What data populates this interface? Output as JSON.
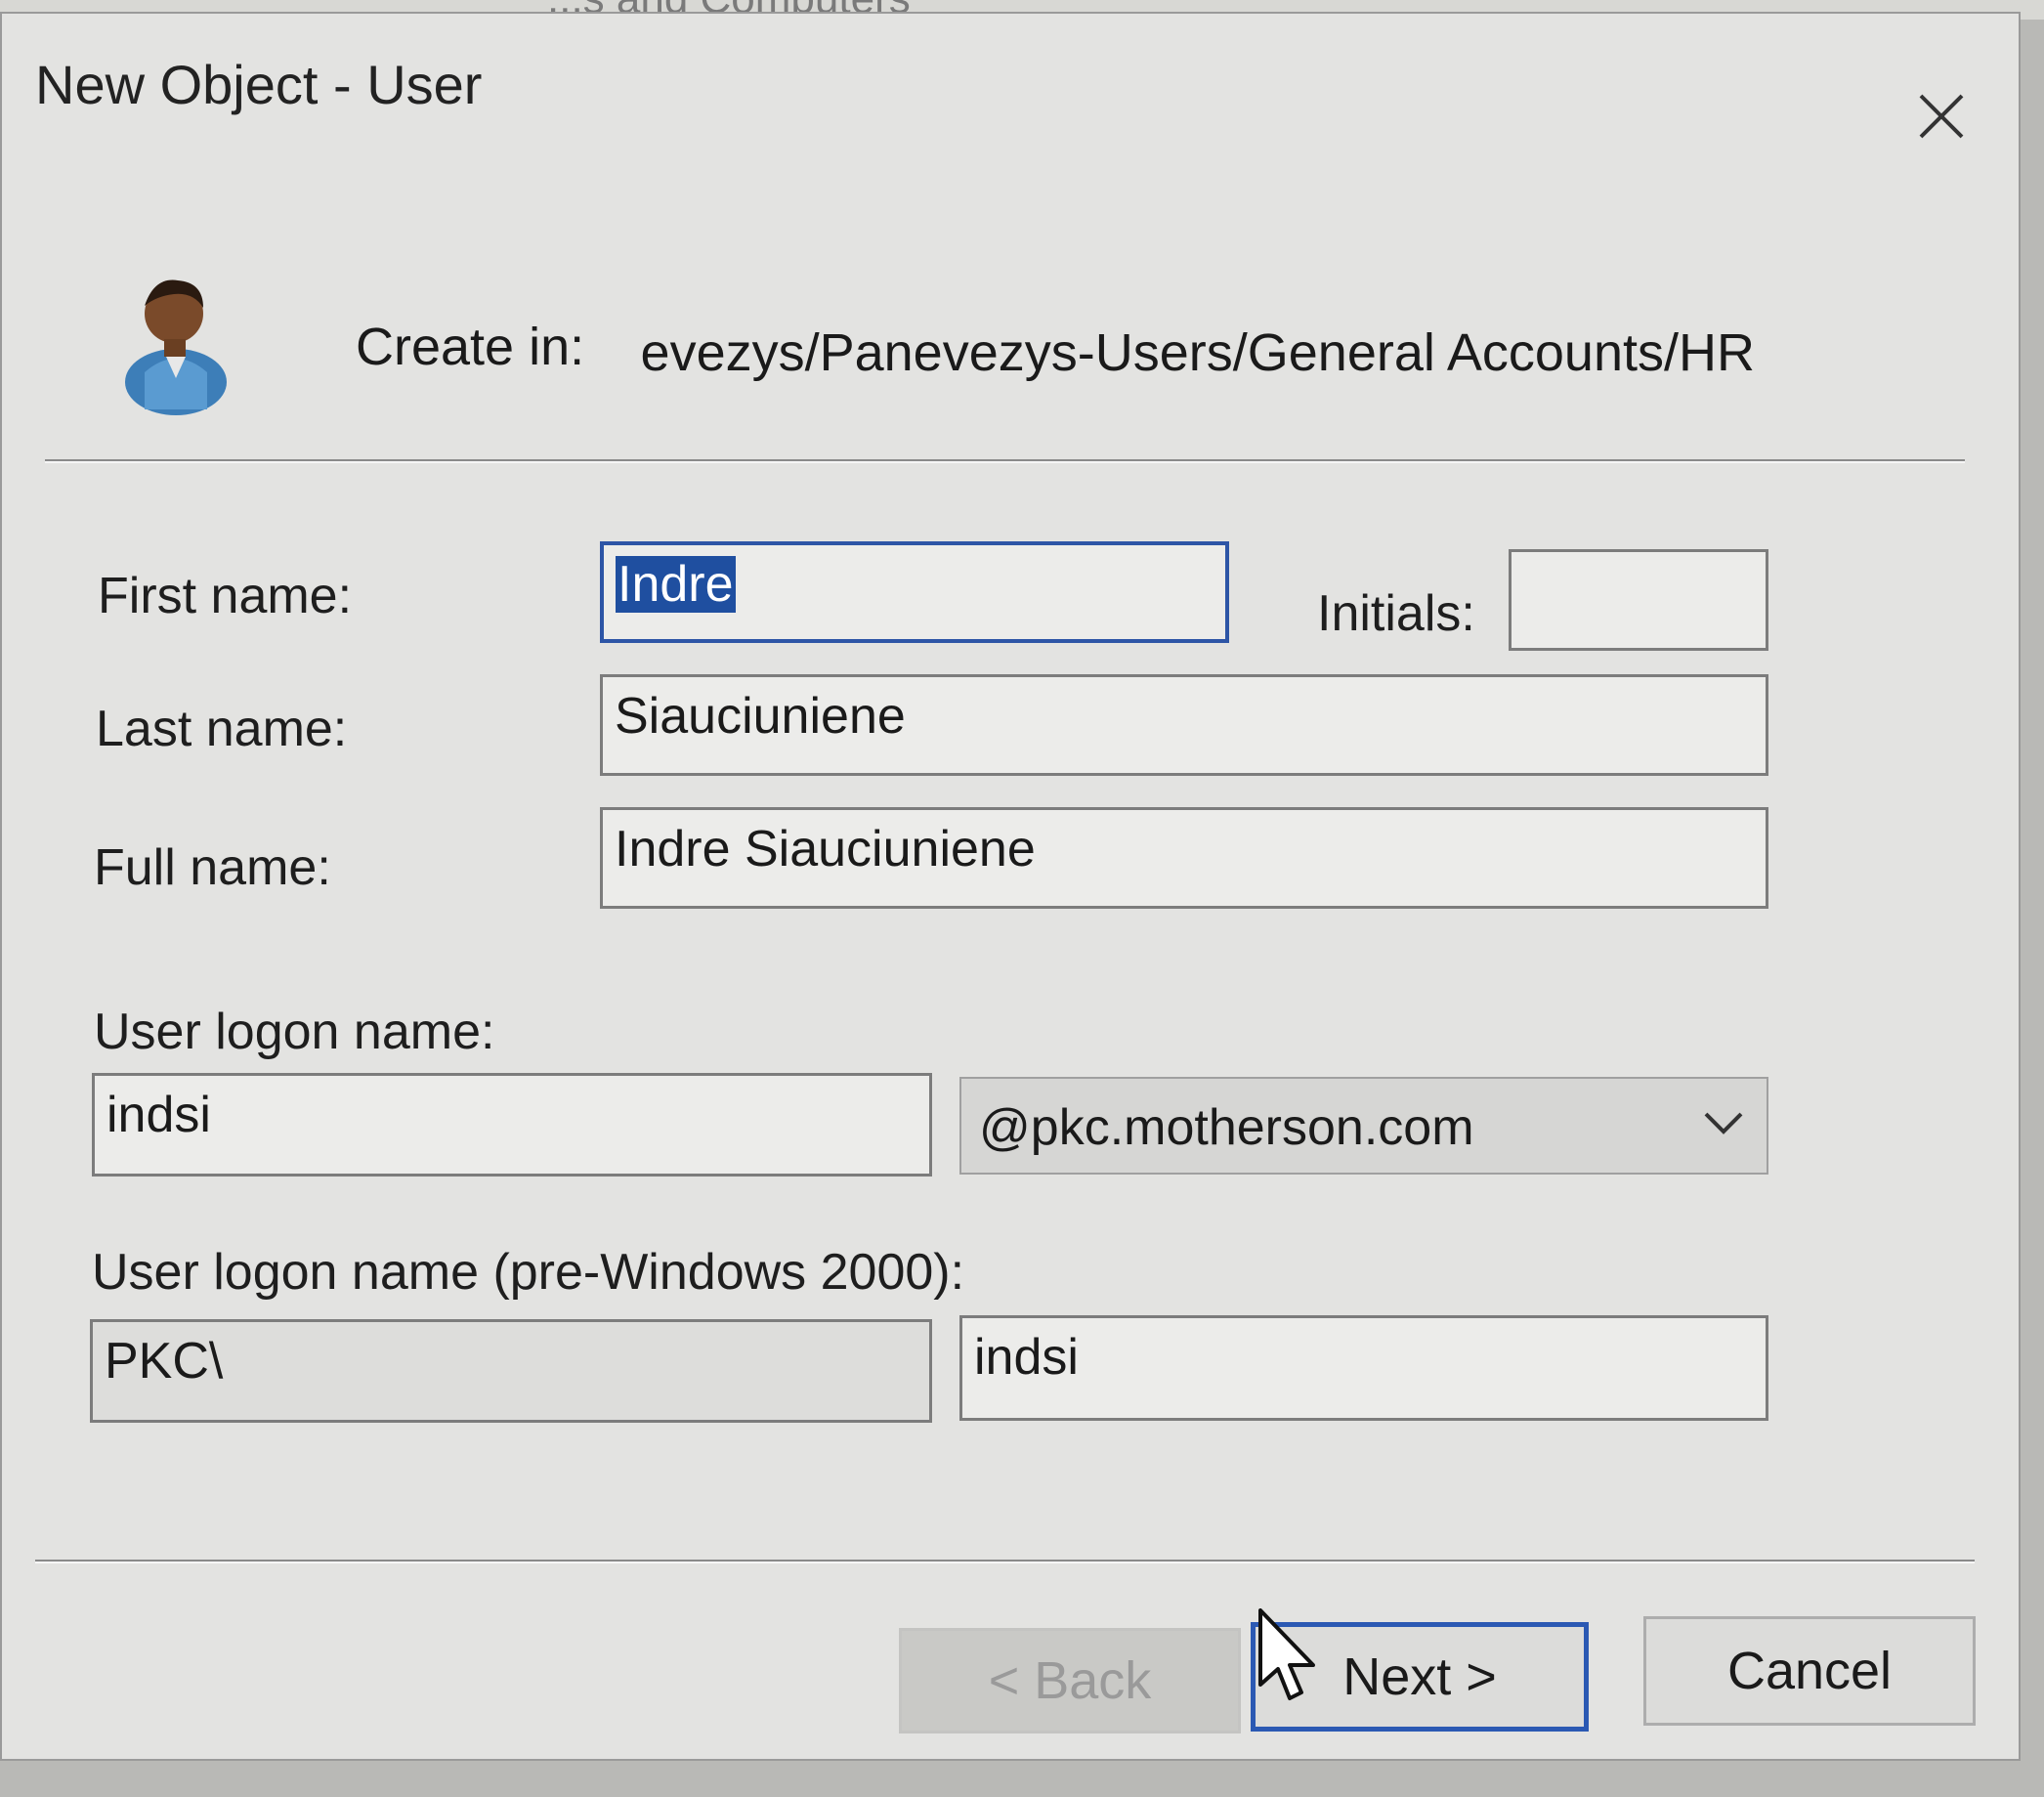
{
  "background": {
    "window_title_fragment": "...s and Computers"
  },
  "dialog": {
    "title": "New Object - User",
    "close_icon": "close-icon",
    "create_in_label": "Create in:",
    "create_in_path": "Panevezys/Panevezys-Users/General Accounts/HR",
    "user_icon": "user-icon"
  },
  "form": {
    "first_name_label": "First name:",
    "first_name_value": "Indre",
    "initials_label": "Initials:",
    "initials_value": "",
    "last_name_label": "Last name:",
    "last_name_value": "Siauciuniene",
    "full_name_label": "Full name:",
    "full_name_value": "Indre Siauciuniene",
    "logon_name_label": "User logon name:",
    "logon_name_value": "indsi",
    "logon_domain_value": "@pkc.motherson.com",
    "pre2000_label": "User logon name (pre-Windows 2000):",
    "pre2000_domain_value": "PKC\\",
    "pre2000_name_value": "indsi"
  },
  "buttons": {
    "back_label": "< Back",
    "next_label": "Next >",
    "cancel_label": "Cancel"
  },
  "colors": {
    "dialog_bg": "#e3e3e1",
    "focus_border": "#2d55a6",
    "selection_bg": "#1f4fa0"
  }
}
